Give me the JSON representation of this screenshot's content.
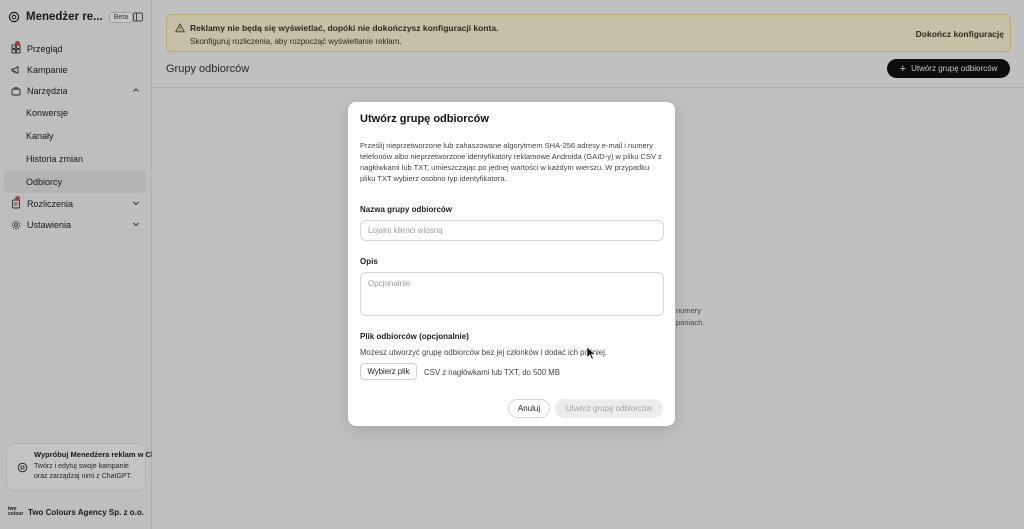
{
  "app": {
    "name": "Menedżer re...",
    "badge": "Beta"
  },
  "sidebar": {
    "items": [
      {
        "label": "Przegląd"
      },
      {
        "label": "Kampanie"
      },
      {
        "label": "Narzędzia"
      },
      {
        "label": "Konwersje"
      },
      {
        "label": "Kanały"
      },
      {
        "label": "Historia zmian"
      },
      {
        "label": "Odbiorcy"
      },
      {
        "label": "Rozliczenia"
      },
      {
        "label": "Ustawienia"
      }
    ],
    "promo": {
      "title": "Wypróbuj Menedżera reklam w ChatGPT",
      "text": "Twórz i edytuj swoje kampanie oraz zarządzaj nimi z ChatGPT."
    },
    "org": {
      "logo_line1": "two",
      "logo_line2": "colour",
      "name": "Two Colours Agency Sp. z o.o."
    }
  },
  "banner": {
    "title": "Reklamy nie będą się wyświetlać, dopóki nie dokończysz konfiguracji konta.",
    "subtitle": "Skonfiguruj rozliczenia, aby rozpocząć wyświetlanie reklam.",
    "action": "Dokończ konfigurację"
  },
  "main": {
    "title": "Grupy odbiorców",
    "create_button": "Utwórz grupę odbiorców",
    "bg_text_1": "numery",
    "bg_text_2": "paniach."
  },
  "modal": {
    "title": "Utwórz grupę odbiorców",
    "description": "Prześlij nieprzetworzone lub zahaszowane algorytmem SHA-256 adresy e-mail i numery telefonów albo nieprzetworzone identyfikatory reklamowe Androida (GAID-y) w pliku CSV z nagłówkami lub TXT, umieszczając po jednej wartości w każdym wierszu. W przypadku pliku TXT wybierz osobno typ identyfikatora.",
    "name_label": "Nazwa grupy odbiorców",
    "name_placeholder": "Lojalni klienci wiosną",
    "desc_label": "Opis",
    "desc_placeholder": "Opcjonalnie",
    "file_label": "Plik odbiorców (opcjonalnie)",
    "file_hint": "Możesz utworzyć grupę odbiorców bez jej członków i dodać ich później.",
    "file_button": "Wybierz plik",
    "file_info": "CSV z nagłówkami lub TXT, do 500 MB",
    "cancel": "Anuluj",
    "submit": "Utwórz grupę odbiorców"
  },
  "colors": {
    "accent": "#111111",
    "banner_bg": "#fff6d9",
    "notification_dot": "#e5484d"
  }
}
